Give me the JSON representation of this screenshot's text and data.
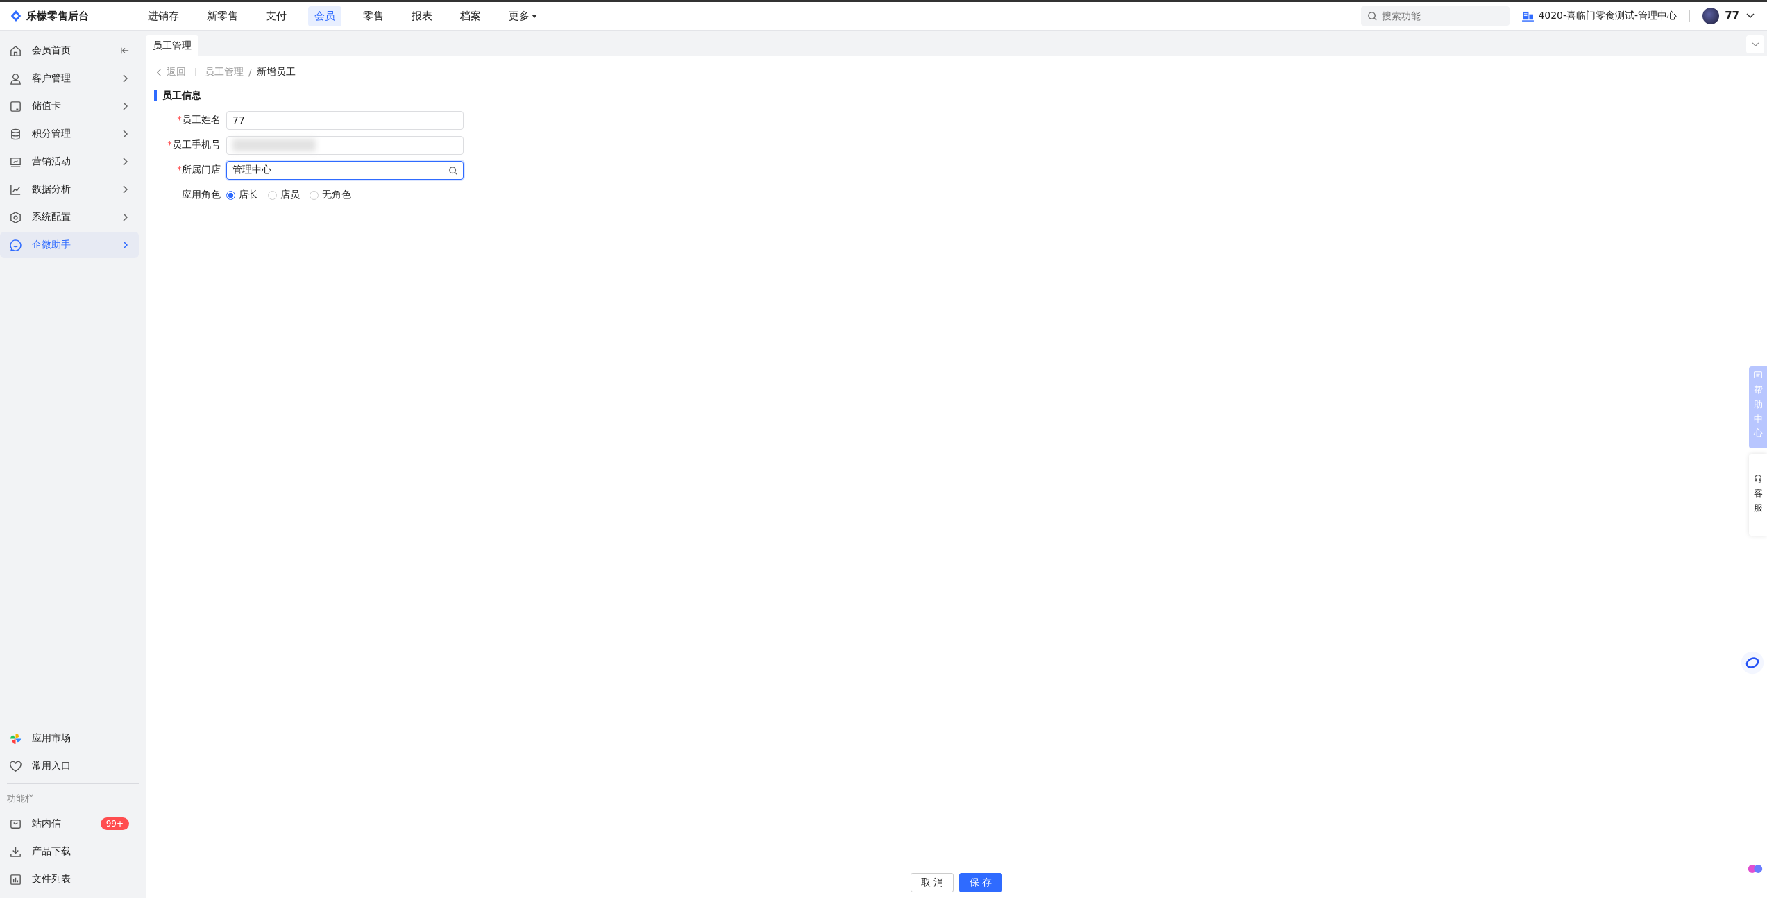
{
  "brand": {
    "name": "乐檬零售后台"
  },
  "top_nav": [
    {
      "label": "进销存",
      "selected": false
    },
    {
      "label": "新零售",
      "selected": false
    },
    {
      "label": "支付",
      "selected": false
    },
    {
      "label": "会员",
      "selected": true
    },
    {
      "label": "零售",
      "selected": false
    },
    {
      "label": "报表",
      "selected": false
    },
    {
      "label": "档案",
      "selected": false
    },
    {
      "label": "更多",
      "selected": false,
      "dropdown": true
    }
  ],
  "search": {
    "placeholder": "搜索功能"
  },
  "store": "4020-喜临门零食测试-管理中心",
  "user": {
    "name": "77"
  },
  "sidebar": {
    "items": [
      {
        "label": "会员首页",
        "selected": false
      },
      {
        "label": "客户管理",
        "selected": false
      },
      {
        "label": "储值卡",
        "selected": false
      },
      {
        "label": "积分管理",
        "selected": false
      },
      {
        "label": "营销活动",
        "selected": false
      },
      {
        "label": "数据分析",
        "selected": false
      },
      {
        "label": "系统配置",
        "selected": false
      },
      {
        "label": "企微助手",
        "selected": true
      }
    ],
    "bottom_items": [
      {
        "label": "应用市场"
      },
      {
        "label": "常用入口"
      }
    ],
    "section_title": "功能栏",
    "function_items": [
      {
        "label": "站内信",
        "badge": "99+"
      },
      {
        "label": "产品下载"
      },
      {
        "label": "文件列表"
      }
    ]
  },
  "page_tabs": [
    {
      "label": "员工管理",
      "selected": true
    }
  ],
  "breadcrumb": {
    "back": "返回",
    "separator": "/",
    "items": [
      "员工管理",
      "新增员工"
    ]
  },
  "form": {
    "title": "员工信息",
    "fields": [
      {
        "label": "员工姓名",
        "required_mark": "*",
        "kind": "text",
        "value": "77",
        "focused": false
      },
      {
        "label": "员工手机号",
        "required_mark": "*",
        "kind": "redacted",
        "focused": false
      },
      {
        "label": "所属门店",
        "required_mark": "*",
        "kind": "search",
        "value": "管理中心",
        "focused": true
      }
    ],
    "role": {
      "label": "应用角色",
      "options": [
        {
          "label": "店长",
          "selected": true
        },
        {
          "label": "店员",
          "selected": false
        },
        {
          "label": "无角色",
          "selected": false
        }
      ]
    }
  },
  "footer_buttons": [
    {
      "label": "取 消",
      "kind": "default"
    },
    {
      "label": "保 存",
      "kind": "primary"
    }
  ],
  "side_tabs": [
    {
      "label": "帮助中心",
      "kind": "help"
    },
    {
      "label": "客服",
      "kind": "service"
    }
  ]
}
